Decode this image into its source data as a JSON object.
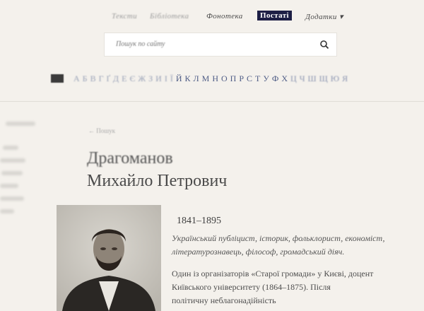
{
  "nav": {
    "items": [
      {
        "label": "Тексти"
      },
      {
        "label": "Бібліотека"
      },
      {
        "label": "Фонотека"
      },
      {
        "label": "Постаті"
      },
      {
        "label": "Додатки"
      }
    ]
  },
  "search": {
    "placeholder": "Пошук по сайту"
  },
  "alphabet": [
    "А",
    "Б",
    "В",
    "Г",
    "Ґ",
    "Д",
    "Е",
    "Є",
    "Ж",
    "З",
    "И",
    "І",
    "Ї",
    "Й",
    "К",
    "Л",
    "М",
    "Н",
    "О",
    "П",
    "Р",
    "С",
    "Т",
    "У",
    "Ф",
    "Х",
    "Ц",
    "Ч",
    "Ш",
    "Щ",
    "Ю",
    "Я"
  ],
  "breadcrumb": "Пошук",
  "person": {
    "surname": "Драгоманов",
    "name": "Михайло Петрович",
    "years": "1841–1895",
    "desc_line1": "Український публіцист, історик, фольклорист, економіст,",
    "desc_line2": "літературознавець, філософ, громадський діяч."
  },
  "bio": {
    "line1": "Один із організаторів «Старої громади» у Києві, доцент",
    "line2": "Київського університету (1864–1875). Після",
    "line3": "політичну неблагонадійність"
  },
  "colors": {
    "accent": "#1d1f45",
    "background": "#f4f1ec"
  }
}
